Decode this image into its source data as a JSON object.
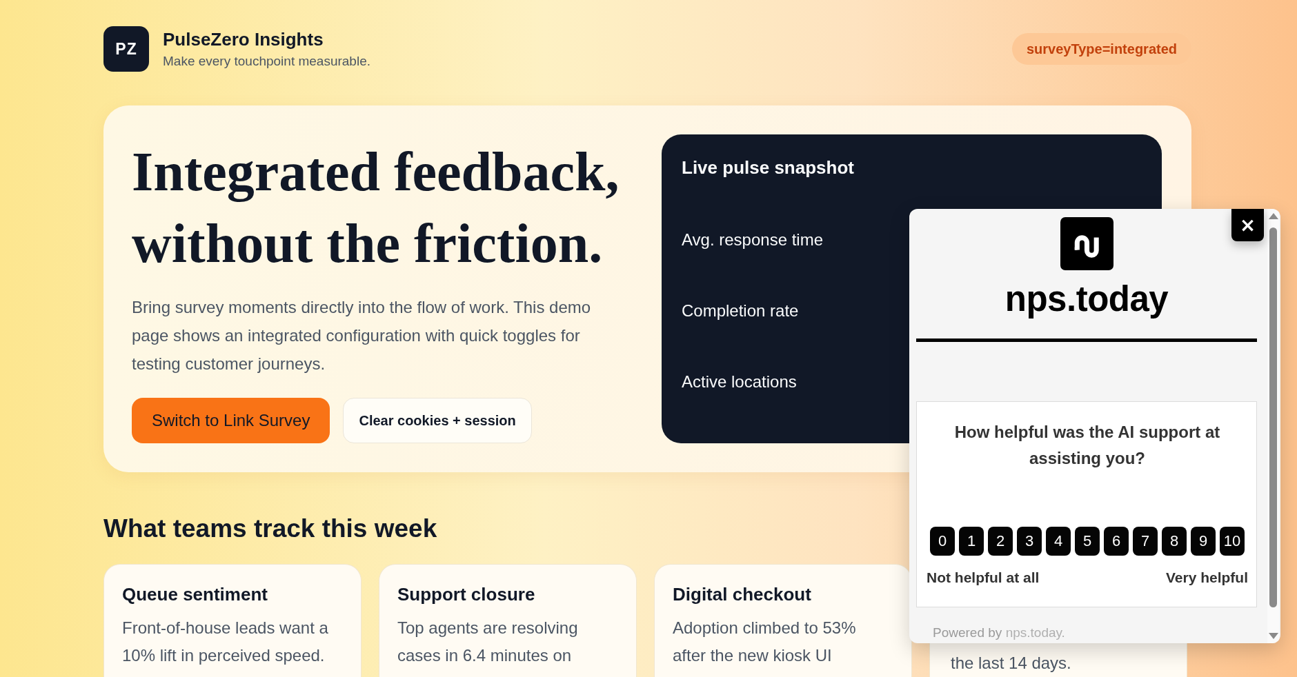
{
  "brand": {
    "logo": "PZ",
    "name": "PulseZero Insights",
    "tagline": "Make every touchpoint measurable."
  },
  "mode_badge": "surveyType=integrated",
  "hero": {
    "heading_lines": [
      "Integrated feedback,",
      "without the friction."
    ],
    "description": "Bring survey moments directly into the flow of work. This demo page shows an integrated configuration with quick toggles for testing customer journeys.",
    "buttons": [
      {
        "label": "Switch to Link Survey",
        "kind": "primary"
      },
      {
        "label": "Clear cookies + session",
        "kind": "secondary"
      }
    ]
  },
  "snapshot": {
    "title": "Live pulse snapshot",
    "metrics": [
      "Avg. response time",
      "Completion rate",
      "Active locations"
    ]
  },
  "section": {
    "title": "What teams track this week",
    "cards": [
      {
        "title": "Queue sentiment",
        "text": "Front-of-house leads want a 10% lift in perceived speed."
      },
      {
        "title": "Support closure",
        "text": "Top agents are resolving cases in 6.4 minutes on"
      },
      {
        "title": "Digital checkout",
        "text": "Adoption climbed to 53% after the new kiosk UI"
      },
      {
        "text": "the last 14 days."
      }
    ]
  },
  "survey_popup": {
    "close": "×",
    "brand": "nps.today",
    "question": "How helpful was the AI support at assisting you?",
    "scale": [
      "0",
      "1",
      "2",
      "3",
      "4",
      "5",
      "6",
      "7",
      "8",
      "9",
      "10"
    ],
    "low_label": "Not helpful at all",
    "high_label": "Very helpful",
    "footer": {
      "text": "Powered by",
      "link": "nps.today."
    }
  }
}
